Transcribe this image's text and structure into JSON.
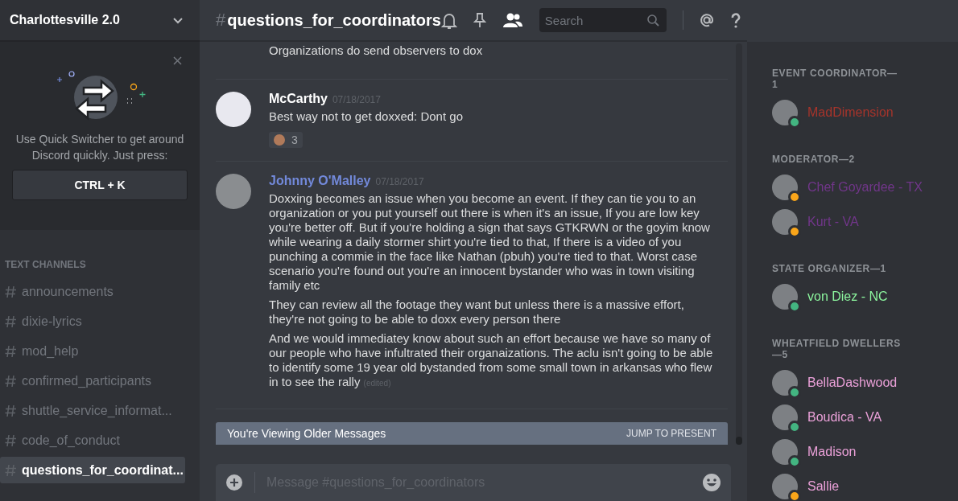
{
  "server": {
    "name": "Charlottesville 2.0"
  },
  "quick_switcher": {
    "text": "Use Quick Switcher to get around Discord quickly. Just press:",
    "shortcut": "CTRL + K"
  },
  "channel_category": "TEXT CHANNELS",
  "channels": [
    {
      "name": "announcements",
      "selected": false
    },
    {
      "name": "dixie-lyrics",
      "selected": false
    },
    {
      "name": "mod_help",
      "selected": false
    },
    {
      "name": "confirmed_participants",
      "selected": false
    },
    {
      "name": "shuttle_service_informat...",
      "selected": false
    },
    {
      "name": "code_of_conduct",
      "selected": false
    },
    {
      "name": "questions_for_coordinat...",
      "selected": true
    }
  ],
  "header": {
    "hash": "#",
    "channel": "questions_for_coordinators",
    "search": {
      "placeholder": "Search"
    }
  },
  "messages": [
    {
      "paragraphs": [
        "Organizations do send observers to dox"
      ]
    },
    {
      "author": "McCarthy",
      "color": "#ffffff",
      "timestamp": "07/18/2017",
      "paragraphs": [
        "Best way not to get doxxed: Dont go"
      ],
      "reaction": {
        "count": "3"
      }
    },
    {
      "author": "Johnny O'Malley",
      "color": "#7289da",
      "timestamp": "07/18/2017",
      "paragraphs": [
        "Doxxing becomes an issue when you become an event. If they can tie you to an organization or you put yourself out there is when it's an issue, If you are low key you're better off. But if you're holding a sign that says GTKRWN or the goyim know while wearing a daily stormer shirt you're tied to that, If there is a video of you punching a commie in the face like Nathan (pbuh) you're tied to that.  Worst case scenario you're found out you're an innocent bystander who was in town visiting family etc",
        "They can review all the footage they want but unless there is a massive effort, they're not going to be able to doxx every person there",
        "And we would immediatey know about such an effort because we have so many of our people who have infultrated their organaizations.  The aclu isn't going to be able to identify some 19 year old bystanded from some small town in arkansas who flew in to see the rally"
      ],
      "edited": "(edited)"
    }
  ],
  "older_banner": {
    "text": "You're Viewing Older Messages",
    "action": "JUMP TO PRESENT"
  },
  "composer": {
    "placeholder": "Message #questions_for_coordinators"
  },
  "member_groups": [
    {
      "title": "EVENT COORDINATOR—1",
      "members": [
        {
          "name": "MadDimension",
          "color": "#a6342b",
          "idle": false
        }
      ]
    },
    {
      "title": "MODERATOR—2",
      "members": [
        {
          "name": "Chef Goyardee - TX",
          "color": "#71368a",
          "idle": true
        },
        {
          "name": "Kurt - VA",
          "color": "#71368a",
          "idle": true
        }
      ]
    },
    {
      "title": "STATE ORGANIZER—1",
      "members": [
        {
          "name": "von Diez - NC",
          "color": "#8cf59e",
          "idle": false
        }
      ]
    },
    {
      "title": "WHEATFIELD DWELLERS—5",
      "members": [
        {
          "name": "BellaDashwood",
          "color": "#eaa0d8",
          "idle": false
        },
        {
          "name": "Boudica - VA",
          "color": "#eaa0d8",
          "idle": false
        },
        {
          "name": "Madison",
          "color": "#eaa0d8",
          "idle": false
        },
        {
          "name": "Sallie",
          "color": "#eaa0d8",
          "idle": true
        }
      ]
    }
  ]
}
